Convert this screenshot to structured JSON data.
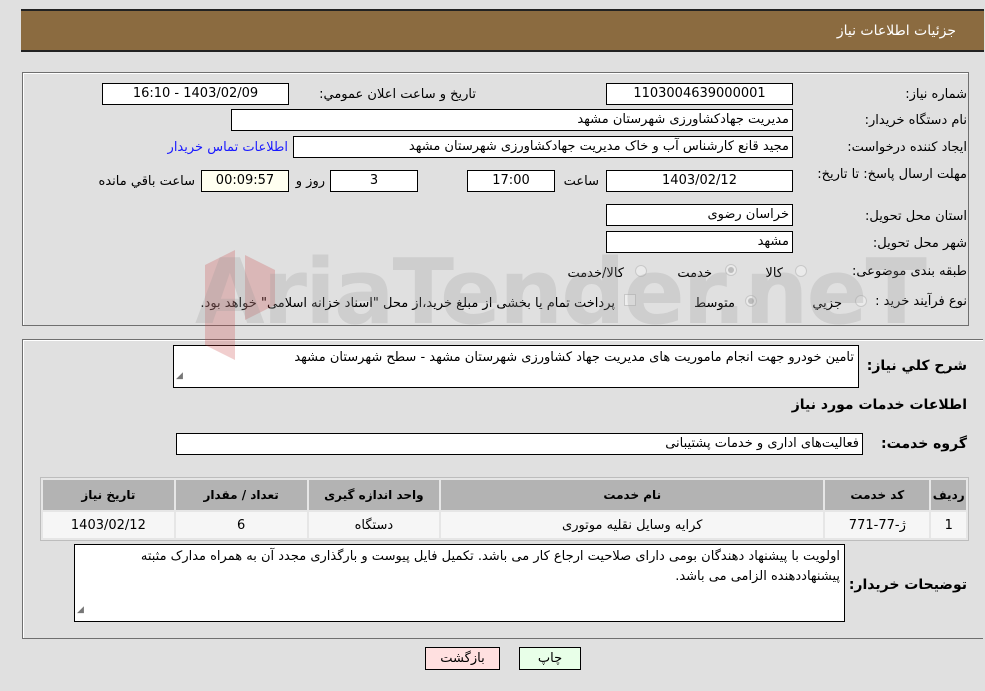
{
  "header": {
    "title": "جزئیات اطلاعات نیاز"
  },
  "form": {
    "need_number": {
      "label": "شماره نیاز:",
      "value": "1103004639000001"
    },
    "announce_datetime": {
      "label": "تاریخ و ساعت اعلان عمومي:",
      "value": "1403/02/09 - 16:10"
    },
    "buyer_org": {
      "label": "نام دستگاه خريدار:",
      "value": "مدیریت جهادکشاورزی شهرستان مشهد"
    },
    "requester": {
      "label": "ايجاد كننده درخواست:",
      "value": "مجید قانع کارشناس آب و خاک مدیریت جهادکشاورزی شهرستان مشهد"
    },
    "buyer_contact_link": "اطلاعات تماس خريدار",
    "deadline": {
      "label": "مهلت ارسال پاسخ: تا تاریخ:",
      "date": "1403/02/12",
      "time_label": "ساعت",
      "time": "17:00",
      "days": "3",
      "days_label": "روز و",
      "remaining": "00:09:57",
      "remaining_label": "ساعت باقي مانده"
    },
    "province": {
      "label": "استان محل تحویل:",
      "value": "خراسان رضوی"
    },
    "city": {
      "label": "شهر محل تحویل:",
      "value": "مشهد"
    },
    "category": {
      "label": "طبقه بندی موضوعی:",
      "options": [
        "کالا",
        "خدمت",
        "کالا/خدمت"
      ],
      "selected": "خدمت"
    },
    "process_type": {
      "label": "نوع فرآیند خرید :",
      "options": [
        "جزيي",
        "متوسط"
      ],
      "selected": "متوسط",
      "treasury_checkbox_label": "پرداخت تمام یا بخشی از مبلغ خرید،از محل \"اسناد خزانه اسلامی\" خواهد بود.",
      "treasury_checked": false
    }
  },
  "description": {
    "label": "شرح کلي نياز:",
    "value": "تامین خودرو جهت انجام ماموریت های مدیریت جهاد کشاورزی شهرستان مشهد - سطح شهرستان مشهد"
  },
  "services_section": {
    "title": "اطلاعات خدمات مورد نياز"
  },
  "service_group": {
    "label": "گروه خدمت:",
    "value": "فعالیت‌های اداری و خدمات پشتیبانی"
  },
  "table": {
    "headers": [
      "رديف",
      "کد خدمت",
      "نام خدمت",
      "واحد اندازه گيری",
      "تعداد / مقدار",
      "تاريخ نياز"
    ],
    "rows": [
      [
        "1",
        "ژ-77-771",
        "کرایه وسایل نقلیه موتوری",
        "دستگاه",
        "6",
        "1403/02/12"
      ]
    ]
  },
  "buyer_notes": {
    "label": "توضيحات خريدار:",
    "value": "اولویت با پیشنهاد دهندگان بومی دارای صلاحیت ارجاع کار می باشد.  تکمیل فایل پیوست و بارگذاری مجدد آن به همراه مدارک مثبته پیشنهاددهنده الزامی می باشد."
  },
  "buttons": {
    "print": "چاپ",
    "back": "بازگشت"
  },
  "watermark": "AriaTender.neT"
}
